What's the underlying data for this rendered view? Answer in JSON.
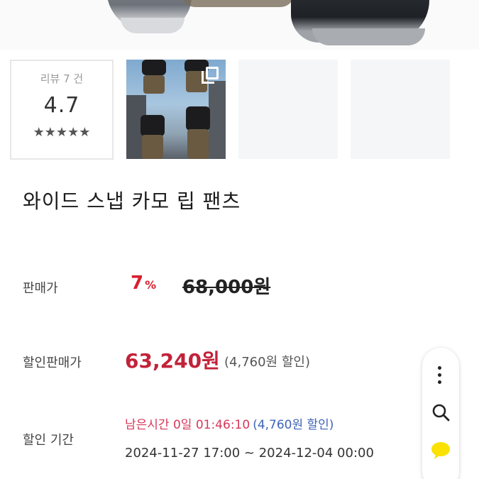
{
  "review": {
    "count_label": "리뷰 7 건",
    "score": "4.7",
    "stars": "★★★★★",
    "rating": 4.7
  },
  "product": {
    "title": "와이드 스냅 카모 립 팬츠"
  },
  "price": {
    "label": "판매가",
    "discount_rate": "7",
    "discount_unit": "%",
    "original": "68,000원"
  },
  "sale": {
    "label": "할인판매가",
    "price": "63,240원",
    "note": "(4,760원 할인)"
  },
  "period": {
    "label": "할인 기간",
    "remaining": "남은시간 0일 01:46:10",
    "remaining_discount": "(4,760원 할인)",
    "range": "2024-11-27 17:00 ~ 2024-12-04 00:00"
  },
  "icons": {
    "multi_image": "multi-image-icon",
    "more": "more-vertical-icon",
    "search": "search-icon",
    "chat": "kakao-chat-icon"
  },
  "colors": {
    "discount_red": "#d71f2f",
    "sale_price": "#c2223a",
    "remaining_time": "#d6375a",
    "remaining_discount": "#3e63b8",
    "kakao_yellow": "#fae100"
  }
}
